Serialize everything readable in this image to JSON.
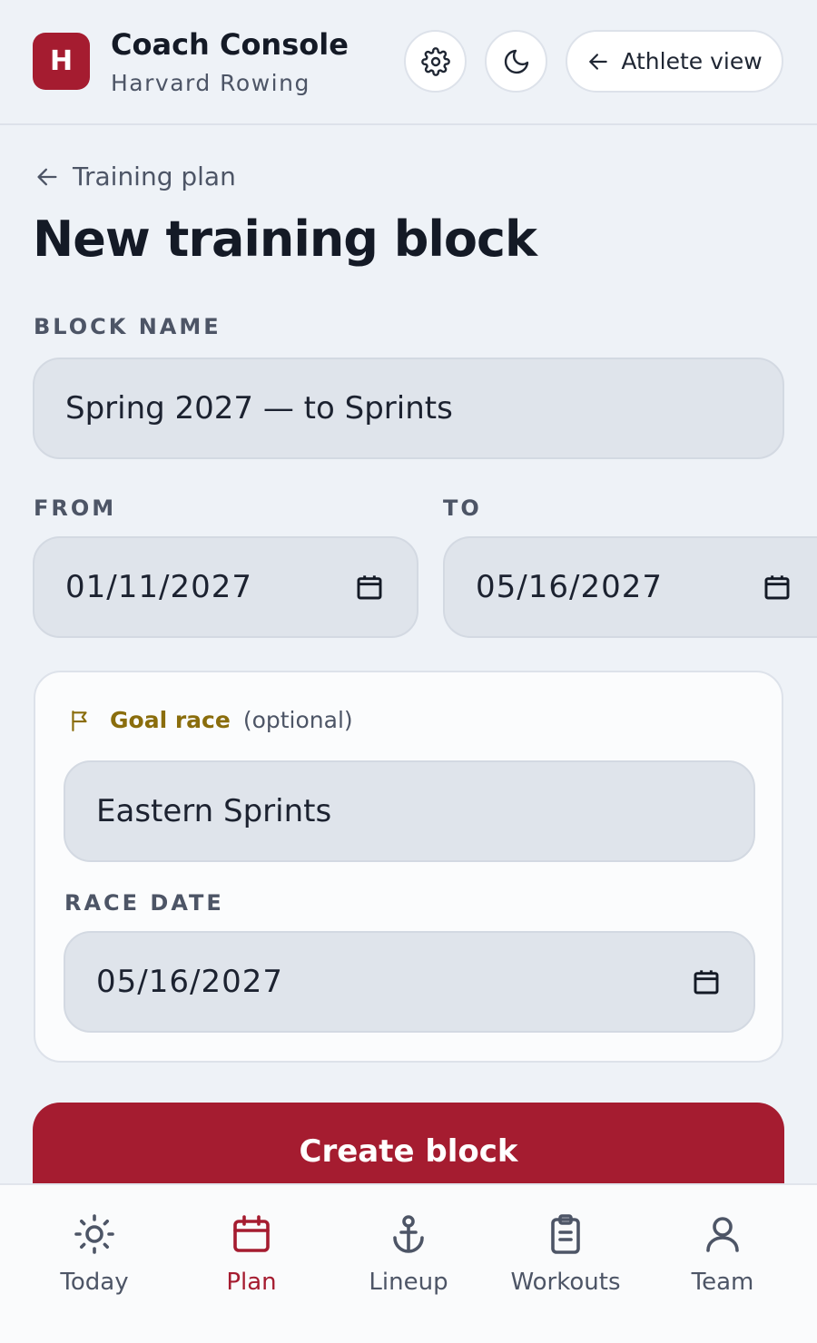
{
  "header": {
    "logo_letter": "H",
    "title": "Coach Console",
    "subtitle": "Harvard Rowing",
    "settings_icon": "gear-icon",
    "theme_icon": "moon-icon",
    "athlete_view_label": "Athlete view"
  },
  "breadcrumb": {
    "back_label": "Training plan"
  },
  "page": {
    "title": "New training block"
  },
  "form": {
    "block_name_label": "BLOCK NAME",
    "block_name_value": "Spring 2027 — to Sprints",
    "from_label": "FROM",
    "from_value": "01/11/2027",
    "to_label": "TO",
    "to_value": "05/16/2027",
    "goal": {
      "icon": "flag-icon",
      "label": "Goal race",
      "optional": "(optional)",
      "race_value": "Eastern Sprints",
      "race_date_label": "RACE DATE",
      "race_date_value": "05/16/2027"
    },
    "submit_label": "Create block"
  },
  "nav": {
    "items": [
      {
        "label": "Today",
        "icon": "sun-icon",
        "active": false
      },
      {
        "label": "Plan",
        "icon": "calendar-icon",
        "active": true
      },
      {
        "label": "Lineup",
        "icon": "anchor-icon",
        "active": false
      },
      {
        "label": "Workouts",
        "icon": "clipboard-icon",
        "active": false
      },
      {
        "label": "Team",
        "icon": "user-icon",
        "active": false
      }
    ]
  },
  "colors": {
    "brand": "#a51c30",
    "goal_accent": "#8a6d0c",
    "background": "#eef2f7",
    "input_bg": "#dfe4eb"
  }
}
